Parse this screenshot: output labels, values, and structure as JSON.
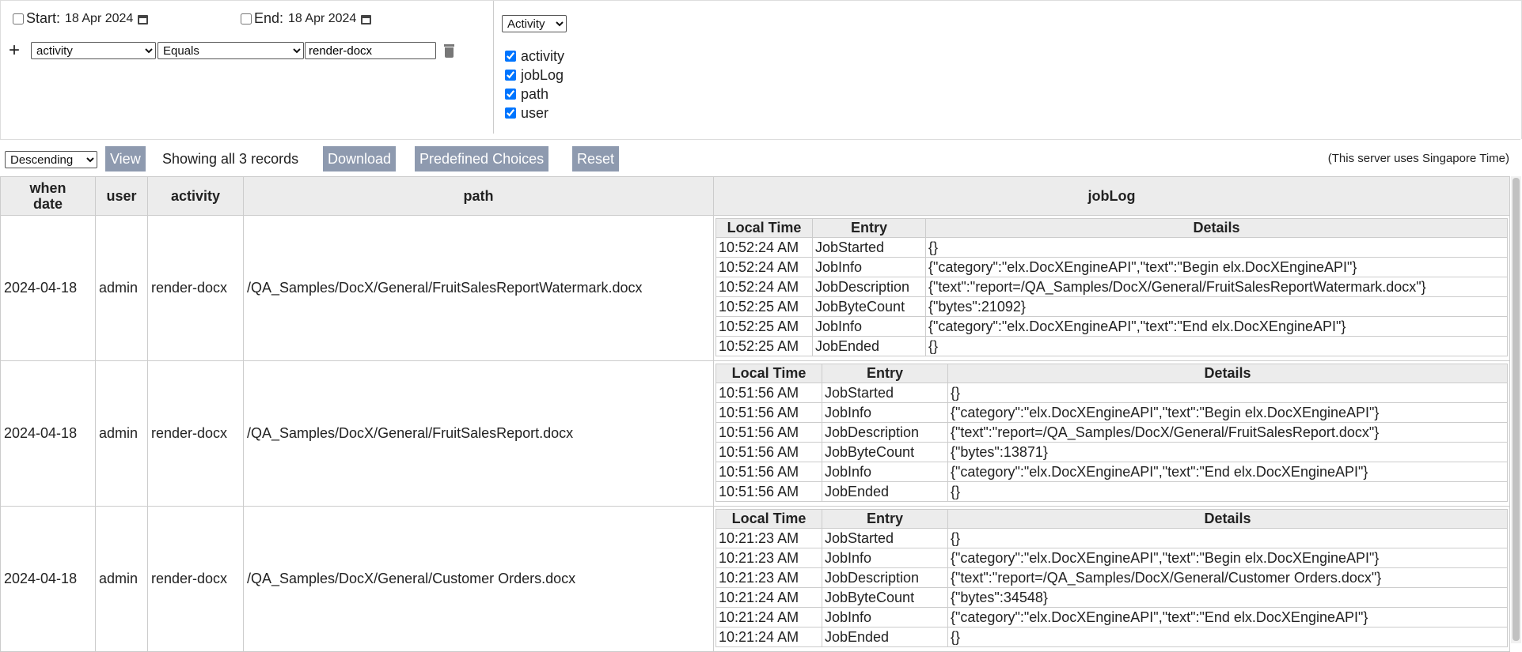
{
  "filters": {
    "start_label": "Start:",
    "start_date": "18 Apr 2024",
    "end_label": "End:",
    "end_date": "18 Apr 2024",
    "field_selected": "activity",
    "operator_selected": "Equals",
    "value": "render-docx",
    "add_icon": "plus-icon",
    "delete_icon": "trash-icon"
  },
  "columns_panel": {
    "group_selected": "Activity",
    "checkboxes": [
      {
        "label": "activity",
        "checked": true
      },
      {
        "label": "jobLog",
        "checked": true
      },
      {
        "label": "path",
        "checked": true
      },
      {
        "label": "user",
        "checked": true
      }
    ]
  },
  "toolbar": {
    "order_selected": "Descending",
    "view_label": "View",
    "showing_text": "Showing all 3 records",
    "download_label": "Download",
    "predefined_label": "Predefined Choices",
    "reset_label": "Reset",
    "timezone_note": "(This server uses Singapore Time)",
    "button_color": "#8e9aaf"
  },
  "table": {
    "headers": {
      "when": "when date",
      "user": "user",
      "activity": "activity",
      "path": "path",
      "joblog": "jobLog"
    },
    "joblog_headers": {
      "time": "Local Time",
      "entry": "Entry",
      "details": "Details"
    },
    "rows": [
      {
        "when": "2024-04-18",
        "user": "admin",
        "activity": "render-docx",
        "path": "/QA_Samples/DocX/General/FruitSalesReportWatermark.docx",
        "log": [
          {
            "time": "10:52:24 AM",
            "entry": "JobStarted",
            "details": "{}"
          },
          {
            "time": "10:52:24 AM",
            "entry": "JobInfo",
            "details": "{\"category\":\"elx.DocXEngineAPI\",\"text\":\"Begin elx.DocXEngineAPI\"}"
          },
          {
            "time": "10:52:24 AM",
            "entry": "JobDescription",
            "details": "{\"text\":\"report=/QA_Samples/DocX/General/FruitSalesReportWatermark.docx\"}"
          },
          {
            "time": "10:52:25 AM",
            "entry": "JobByteCount",
            "details": "{\"bytes\":21092}"
          },
          {
            "time": "10:52:25 AM",
            "entry": "JobInfo",
            "details": "{\"category\":\"elx.DocXEngineAPI\",\"text\":\"End elx.DocXEngineAPI\"}"
          },
          {
            "time": "10:52:25 AM",
            "entry": "JobEnded",
            "details": "{}"
          }
        ]
      },
      {
        "when": "2024-04-18",
        "user": "admin",
        "activity": "render-docx",
        "path": "/QA_Samples/DocX/General/FruitSalesReport.docx",
        "log": [
          {
            "time": "10:51:56 AM",
            "entry": "JobStarted",
            "details": "{}"
          },
          {
            "time": "10:51:56 AM",
            "entry": "JobInfo",
            "details": "{\"category\":\"elx.DocXEngineAPI\",\"text\":\"Begin elx.DocXEngineAPI\"}"
          },
          {
            "time": "10:51:56 AM",
            "entry": "JobDescription",
            "details": "{\"text\":\"report=/QA_Samples/DocX/General/FruitSalesReport.docx\"}"
          },
          {
            "time": "10:51:56 AM",
            "entry": "JobByteCount",
            "details": "{\"bytes\":13871}"
          },
          {
            "time": "10:51:56 AM",
            "entry": "JobInfo",
            "details": "{\"category\":\"elx.DocXEngineAPI\",\"text\":\"End elx.DocXEngineAPI\"}"
          },
          {
            "time": "10:51:56 AM",
            "entry": "JobEnded",
            "details": "{}"
          }
        ]
      },
      {
        "when": "2024-04-18",
        "user": "admin",
        "activity": "render-docx",
        "path": "/QA_Samples/DocX/General/Customer Orders.docx",
        "log": [
          {
            "time": "10:21:23 AM",
            "entry": "JobStarted",
            "details": "{}"
          },
          {
            "time": "10:21:23 AM",
            "entry": "JobInfo",
            "details": "{\"category\":\"elx.DocXEngineAPI\",\"text\":\"Begin elx.DocXEngineAPI\"}"
          },
          {
            "time": "10:21:23 AM",
            "entry": "JobDescription",
            "details": "{\"text\":\"report=/QA_Samples/DocX/General/Customer Orders.docx\"}"
          },
          {
            "time": "10:21:24 AM",
            "entry": "JobByteCount",
            "details": "{\"bytes\":34548}"
          },
          {
            "time": "10:21:24 AM",
            "entry": "JobInfo",
            "details": "{\"category\":\"elx.DocXEngineAPI\",\"text\":\"End elx.DocXEngineAPI\"}"
          },
          {
            "time": "10:21:24 AM",
            "entry": "JobEnded",
            "details": "{}"
          }
        ]
      }
    ]
  }
}
